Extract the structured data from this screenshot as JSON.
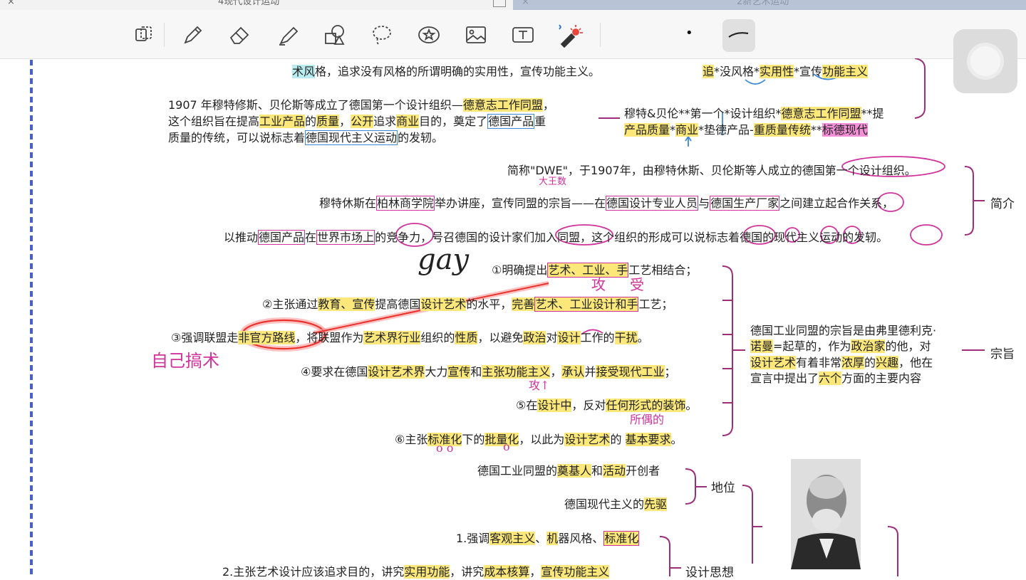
{
  "tabs": [
    {
      "title": "4现代设计运动",
      "close": "×",
      "active": true
    },
    {
      "title": "2新艺术运动",
      "close": "×",
      "active": false
    }
  ],
  "toolbar": {
    "tools": [
      "lasso-select-icon",
      "pen-icon",
      "eraser-icon",
      "highlighter-icon",
      "shapes-icon",
      "lasso-icon",
      "sticker-icon",
      "image-icon",
      "text-box-icon",
      "laser-pointer-icon"
    ],
    "pen_size_dot": "•",
    "stroke_style": "～"
  },
  "content": {
    "row1_prefix": "术风",
    "row1_rest": "格，追求没有风格的所谓明确的实用性，宣传功能主义。",
    "row1_note": {
      "p1": "追",
      "p2": "*没风格*",
      "p3": "实用性",
      "p4": "*宣传",
      "p5": "功能主义"
    },
    "para1": {
      "l1_a": "1907 年穆特修斯、贝伦斯等成立了德国第一个设计组织—",
      "l1_b": "德意志工作同盟",
      "l1_c": "，",
      "l2_a": "这个组织旨在提高",
      "l2_b": "工业产品",
      "l2_c": "的",
      "l2_d": "质量",
      "l2_e": "，",
      "l2_f": "公开",
      "l2_g": "追求",
      "l2_h": "商业",
      "l2_i": "目的，奠定了",
      "l2_j": "德国产品",
      "l2_k": "重",
      "l3_a": "质量的传统，可以说标志着",
      "l3_b": "德国现代主义运动",
      "l3_c": "的发轫。"
    },
    "note1": {
      "l1_a": "穆特&贝伦**第一个*设计组织*",
      "l1_b": "德意志工作同盟",
      "l1_c": "**提",
      "l2_a": "产品质量",
      "l2_b": "*",
      "l2_c": "商业",
      "l2_d": "*垫德产品-",
      "l2_e": "重质量传统",
      "l2_f": "**",
      "l2_g": "标德现代"
    },
    "intro": {
      "l1": "简称\"DWE\"，于1907年，由穆特休斯、贝伦斯等人成立的德国第一个设计组织。",
      "l2_a": "穆特休斯在",
      "l2_b": "柏林商学院",
      "l2_c": "举办讲座，宣传同盟的宗旨——在",
      "l2_d": "德国设计专业人员",
      "l2_e": "与",
      "l2_f": "德国生产厂家",
      "l2_g": "之间建立起合作关系，",
      "l3_a": "以推动",
      "l3_b": "德国产品",
      "l3_c": "在",
      "l3_d": "世界市场上",
      "l3_e": "的竞争力，号召德国的设计家们加入同盟，这个组织的形成可以说标志着德国的现代主义运动的发轫。",
      "label": "简介"
    },
    "purpose": {
      "p1_a": "①明确提出",
      "p1_b": "艺术、工业、手",
      "p1_c": "工艺相结合；",
      "p2_a": "②主张通过",
      "p2_b": "教育、宣传",
      "p2_c": "提高德国",
      "p2_d": "设计艺术",
      "p2_e": "的水平，",
      "p2_f": "完善",
      "p2_g": "艺术、工业设计和手",
      "p2_h": "工艺；",
      "p3_a": "③强调联盟走",
      "p3_b": "非官方路线",
      "p3_c": "，将联盟作为",
      "p3_d": "艺术界行业",
      "p3_e": "组织的",
      "p3_f": "性质",
      "p3_g": "，以避免",
      "p3_h": "政治",
      "p3_i": "对",
      "p3_j": "设计",
      "p3_k": "工作的",
      "p3_l": "干扰",
      "p3_m": "。",
      "p4_a": "④要求在德国",
      "p4_b": "设计艺术界",
      "p4_c": "大力",
      "p4_d": "宣传",
      "p4_e": "和",
      "p4_f": "主张功能主义",
      "p4_g": "，",
      "p4_h": "承认",
      "p4_i": "并",
      "p4_j": "接受现代工业",
      "p4_k": "；",
      "p5_a": "⑤在",
      "p5_b": "设计中",
      "p5_c": "，反对",
      "p5_d": "任何形式的装饰",
      "p5_e": "。",
      "p6_a": "⑥主张",
      "p6_b": "标准化",
      "p6_c": "下的",
      "p6_d": "批量化",
      "p6_e": "，以此为",
      "p6_f": "设计艺术",
      "p6_g": "的 ",
      "p6_h": "基本要求",
      "p6_i": "。",
      "summary": {
        "l1": "德国工业同盟的宗旨是由弗里德利克·",
        "l2_a": "诺曼",
        "l2_b": "=起草的，作为",
        "l2_c": "政治家",
        "l2_d": "的他，对",
        "l3_a": "设计艺术",
        "l3_b": "有着非常",
        "l3_c": "浓厚",
        "l3_d": "的",
        "l3_e": "兴趣",
        "l3_f": "，他在",
        "l4_a": "宣言中提出了",
        "l4_b": "六个",
        "l4_c": "方面的主要内容"
      },
      "label": "宗旨"
    },
    "status": {
      "l1_a": "德国工业同盟的",
      "l1_b": "奠基人",
      "l1_c": "和",
      "l1_d": "活动",
      "l1_e": "开创者",
      "l2_a": "德国现代主义的",
      "l2_b": "先驱",
      "label": "地位"
    },
    "design": {
      "l1_a": "1.强调",
      "l1_b": "客观主义",
      "l1_c": "、",
      "l1_d": "机",
      "l1_e": "器风格、",
      "l1_f": "标准化",
      "l2_a": "2.主张艺术设计应该追求目的，讲究",
      "l2_b": "实用功能",
      "l2_c": "，讲究",
      "l2_d": "成本核算",
      "l2_e": "，",
      "l2_f": "宣传功能主义",
      "label": "设计思想"
    }
  },
  "handwriting": {
    "big_king": "大王数",
    "gay": "gay",
    "attack": "攻",
    "receive": "受",
    "self_dry": "自己搞术",
    "attack_up": "攻↑",
    "wife": "所偶的",
    "oo": "o o",
    "o": "o"
  },
  "colors": {
    "highlight": "#fbe77a",
    "annotation_pink": "#d0339b",
    "annotation_blue": "#3f88d8",
    "bracket": "#9b2f7a",
    "margin_line": "#4a5fc8"
  }
}
